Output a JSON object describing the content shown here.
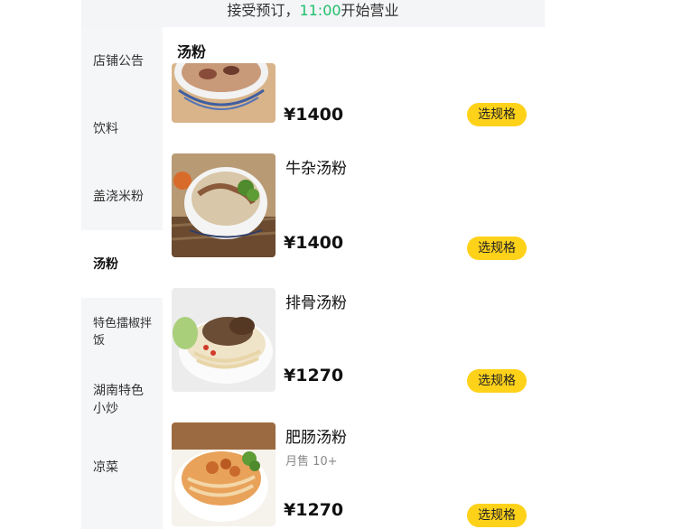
{
  "notice": {
    "prefix": "接受预订，",
    "time": "11:00",
    "suffix": "开始营业"
  },
  "sidebar": {
    "items": [
      {
        "label": "店铺公告"
      },
      {
        "label": "饮料"
      },
      {
        "label": "盖浇米粉"
      },
      {
        "label": "汤粉",
        "active": true
      },
      {
        "label": "特色擂椒拌饭"
      },
      {
        "label": "湖南特色小炒"
      },
      {
        "label": "凉菜"
      }
    ]
  },
  "main": {
    "section_title": "汤粉",
    "items": [
      {
        "name": "",
        "sales": "",
        "price": "¥1400",
        "button": "选规格",
        "image": "noodle-bowl-photo"
      },
      {
        "name": "牛杂汤粉",
        "sales": "",
        "price": "¥1400",
        "button": "选规格",
        "image": "beef-offal-noodle-photo"
      },
      {
        "name": "排骨汤粉",
        "sales": "",
        "price": "¥1270",
        "button": "选规格",
        "image": "spare-rib-noodle-photo"
      },
      {
        "name": "肥肠汤粉",
        "sales": "月售 10+",
        "price": "¥1270",
        "button": "选规格",
        "image": "pork-intestine-noodle-photo"
      }
    ]
  },
  "colors": {
    "accent_button": "#ffd21a",
    "time_green": "#1fbf6a",
    "sidebar_bg": "#f5f6f8"
  }
}
